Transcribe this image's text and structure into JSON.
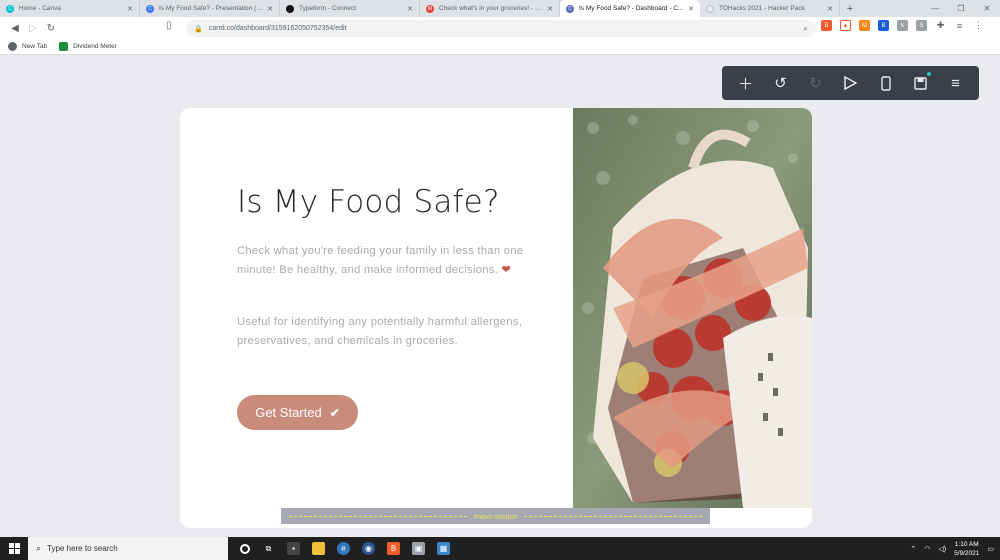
{
  "browser": {
    "tabs": [
      {
        "title": "Home - Canva",
        "color": "#00c4cc",
        "active": false
      },
      {
        "title": "Is My Food Safe? - Presentation (16:9)",
        "color": "#3a78f2",
        "active": false
      },
      {
        "title": "Typeform - Connect",
        "color": "#111111",
        "active": false
      },
      {
        "title": "Check what's in your groceries! - my@...",
        "color": "#ea4335",
        "active": false
      },
      {
        "title": "Is My Food Safe? - Dashboard - C...",
        "color": "#5b6cc0",
        "active": true
      },
      {
        "title": "TOHacks 2021 - Hacker Pack",
        "color": "#e8eaed",
        "active": false
      }
    ],
    "new_tab_symbol": "+",
    "url": "carrd.co/dashboard/3159162050752354/edit",
    "bookmarks": [
      {
        "label": "New Tab",
        "color": "#5f6368"
      },
      {
        "label": "Dividend Meter",
        "color": "#1e8e3e"
      }
    ]
  },
  "editor_toolbar": {
    "buttons": [
      "add",
      "undo",
      "redo",
      "preview",
      "mobile-view",
      "save",
      "menu"
    ]
  },
  "card": {
    "title": "Is My Food Safe?",
    "paragraph1": "Check what you're feeding your family in less than one minute! Be healthy, and make informed decisions.",
    "paragraph2": "Useful for identifying any potentially harmful allergens, preservatives, and chemicals in groceries.",
    "cta_label": "Get Started",
    "cta_color": "#c98b7a"
  },
  "section_marker": "#next-section",
  "taskbar": {
    "search_placeholder": "Type here to search",
    "time": "1:10 AM",
    "date": "5/9/2021"
  }
}
